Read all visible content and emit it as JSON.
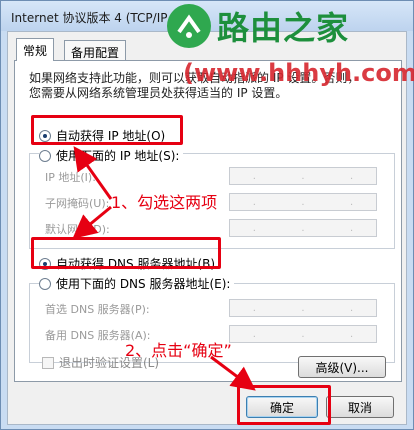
{
  "window": {
    "title": "Internet 协议版本 4 (TCP/IP"
  },
  "tabs": [
    {
      "label": "常规"
    },
    {
      "label": "备用配置"
    }
  ],
  "description": {
    "line1": "如果网络支持此功能，则可以获取自动指派的 IP 设置。否则，",
    "line2": "您需要从网络系统管理员处获得适当的 IP 设置。"
  },
  "ip_section": {
    "auto_label": "自动获得 IP 地址(O)",
    "manual_label": "使用下面的 IP 地址(S):",
    "fields": [
      {
        "label": "IP 地址(I):"
      },
      {
        "label": "子网掩码(U):"
      },
      {
        "label": "默认网关(D):"
      }
    ]
  },
  "dns_section": {
    "auto_label": "自动获得 DNS 服务器地址(B)",
    "manual_label": "使用下面的 DNS 服务器地址(E):",
    "fields": [
      {
        "label": "首选 DNS 服务器(P):"
      },
      {
        "label": "备用 DNS 服务器(A):"
      }
    ]
  },
  "validate_label": "退出时验证设置(L)",
  "buttons": {
    "advanced": "高级(V)...",
    "ok": "确定",
    "cancel": "取消"
  },
  "annotations": {
    "step1": "1、勾选这两项",
    "step2": "2、点击“确定”",
    "color": "#e60012"
  },
  "watermark": {
    "logo_text": "路由之家",
    "url": "(www.hhhyh.com)",
    "logo_color": "#2fa84f"
  }
}
